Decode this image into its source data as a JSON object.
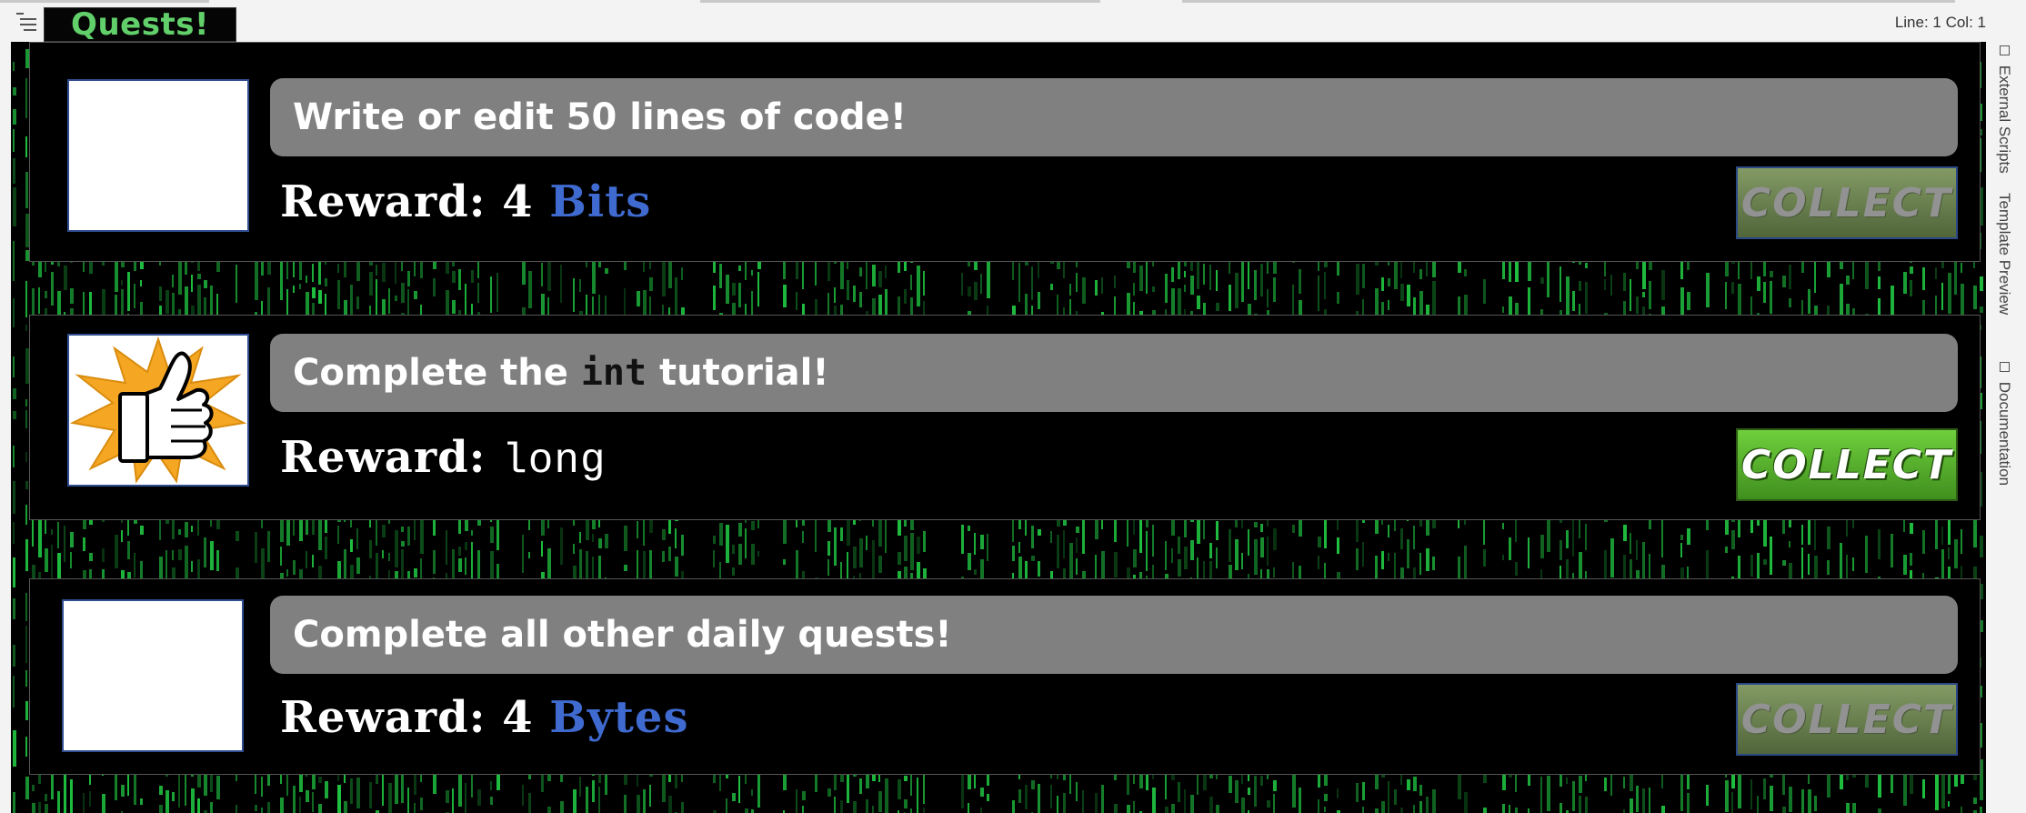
{
  "top_tab": "Quests!",
  "status_text": "Line: 1 Col: 1",
  "side_tabs": [
    "External Scripts",
    "Template Preview",
    "Documentation"
  ],
  "colors": {
    "tab_text": "#62d06a",
    "title_bar": "#808080",
    "reward_unit": "#3f6ad0",
    "collect_active": "#4fae28",
    "collect_disabled": "#75885a",
    "rain": "#1fbf3f"
  },
  "quests": [
    {
      "title": "Write or edit 50 lines of code!",
      "reward_label": "Reward:",
      "reward_amount": "4",
      "reward_unit": "Bits",
      "collect_label": "COLLECT",
      "collect_enabled": false,
      "thumbnail": "blank"
    },
    {
      "title_before": "Complete the",
      "title_code": "int",
      "title_after": "tutorial!",
      "reward_label": "Reward:",
      "reward_value": "long",
      "collect_label": "COLLECT",
      "collect_enabled": true,
      "thumbnail": "thumbs-up-icon"
    },
    {
      "title": "Complete all other daily quests!",
      "reward_label": "Reward:",
      "reward_amount": "4",
      "reward_unit": "Bytes",
      "collect_label": "COLLECT",
      "collect_enabled": false,
      "thumbnail": "blank"
    }
  ]
}
